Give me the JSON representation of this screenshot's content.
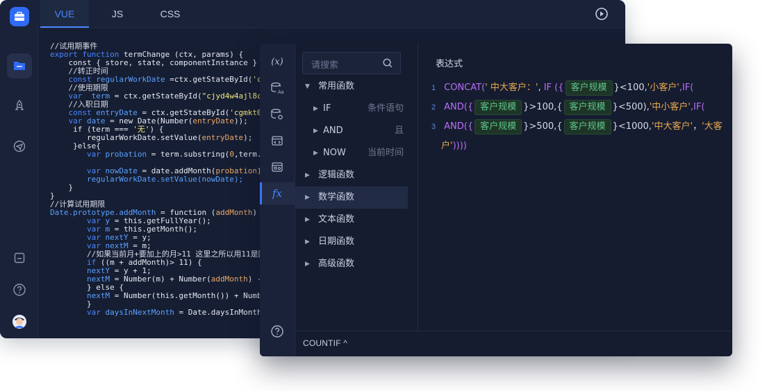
{
  "editor": {
    "tabs": [
      {
        "label": "VUE",
        "active": true
      },
      {
        "label": "JS",
        "active": false
      },
      {
        "label": "CSS",
        "active": false
      }
    ],
    "code": [
      [
        [
          "cm",
          "//试用期事件"
        ]
      ],
      [
        [
          "kw",
          "export function "
        ],
        [
          "pl",
          "termChange (ctx, params) {"
        ]
      ],
      [
        [
          "pl",
          "    const { store, state, componentInstance } = ctx;"
        ]
      ],
      [
        [
          "cm",
          "    //转正时间"
        ]
      ],
      [
        [
          "kw",
          "    const "
        ],
        [
          "vr",
          "regularWorkDate "
        ],
        [
          "pl",
          "=ctx.getStateById("
        ],
        [
          "st",
          "'coetzus"
        ]
      ],
      [
        [
          "cm",
          "    //使用期限"
        ]
      ],
      [
        [
          "kw",
          "    var  "
        ],
        [
          "vr",
          "term "
        ],
        [
          "pl",
          "= ctx.getStateById("
        ],
        [
          "st",
          "\"cjyd4w4ajl8cgz39\""
        ],
        [
          "pl",
          ")."
        ]
      ],
      [
        [
          "cm",
          "    //入职日期"
        ]
      ],
      [
        [
          "kw",
          "    const "
        ],
        [
          "vr",
          "entryDate "
        ],
        [
          "pl",
          "= ctx.getStateById("
        ],
        [
          "st",
          "'cgmkt0m3a4b"
        ]
      ],
      [
        [
          "kw",
          "    var "
        ],
        [
          "vr",
          "date "
        ],
        [
          "pl",
          "= new Date(Number("
        ],
        [
          "num",
          "entryDate"
        ],
        [
          "pl",
          "));"
        ]
      ],
      [
        [
          "pl",
          "     if (term === "
        ],
        [
          "st",
          "'无'"
        ],
        [
          "pl",
          ") {"
        ]
      ],
      [
        [
          "pl",
          "        regularWorkDate.setValue("
        ],
        [
          "num",
          "entryDate"
        ],
        [
          "pl",
          ");"
        ]
      ],
      [
        [
          "pl",
          "     }else{"
        ]
      ],
      [
        [
          "kw",
          "        var "
        ],
        [
          "vr",
          "probation "
        ],
        [
          "pl",
          "= term.substring("
        ],
        [
          "num",
          "0"
        ],
        [
          "pl",
          ",term.length-2"
        ]
      ],
      [
        [
          "pl",
          ""
        ]
      ],
      [
        [
          "kw",
          "        var "
        ],
        [
          "vr",
          "nowDate "
        ],
        [
          "pl",
          "= date.addMonth("
        ],
        [
          "num",
          "probation"
        ],
        [
          "pl",
          ");   //c"
        ]
      ],
      [
        [
          "vr",
          "        regularWorkDate.setValue(nowDate);"
        ]
      ],
      [
        [
          "pl",
          "    }"
        ]
      ],
      [
        [
          "pl",
          "}"
        ]
      ],
      [
        [
          "cm",
          "//计算试用期限"
        ]
      ],
      [
        [
          "vr",
          "Date.prototype.addMonth "
        ],
        [
          "pl",
          "= function ("
        ],
        [
          "num",
          "addMonth"
        ],
        [
          "pl",
          ") {"
        ]
      ],
      [
        [
          "kw",
          "        var "
        ],
        [
          "vr",
          "y "
        ],
        [
          "pl",
          "= this.getFullYear();"
        ]
      ],
      [
        [
          "kw",
          "        var "
        ],
        [
          "vr",
          "m "
        ],
        [
          "pl",
          "= this.getMonth();"
        ]
      ],
      [
        [
          "kw",
          "        var "
        ],
        [
          "vr",
          "nextY "
        ],
        [
          "pl",
          "= y;"
        ]
      ],
      [
        [
          "kw",
          "        var "
        ],
        [
          "vr",
          "nextM "
        ],
        [
          "pl",
          "= m;"
        ]
      ],
      [
        [
          "cm",
          "        //如果当前月+要加上的月>11 这里之所以用11是因为"
        ]
      ],
      [
        [
          "kw",
          "        if "
        ],
        [
          "pl",
          "((m + addMonth)> 11) {"
        ]
      ],
      [
        [
          "vr",
          "        nextY "
        ],
        [
          "pl",
          "= y + 1;"
        ]
      ],
      [
        [
          "vr",
          "        nextM "
        ],
        [
          "pl",
          "= Number(m) + Number("
        ],
        [
          "num",
          "addMonth"
        ],
        [
          "pl",
          ") - 12;"
        ]
      ],
      [
        [
          "pl",
          "        } else {"
        ]
      ],
      [
        [
          "vr",
          "        nextM "
        ],
        [
          "pl",
          "= Number(this.getMonth()) + Number("
        ],
        [
          "num",
          "ad"
        ]
      ],
      [
        [
          "pl",
          "        }"
        ]
      ],
      [
        [
          "kw",
          "        var "
        ],
        [
          "vr",
          "daysInNextMonth "
        ],
        [
          "pl",
          "= Date.daysInMonth("
        ],
        [
          "num",
          "next"
        ]
      ]
    ]
  },
  "formula": {
    "search_placeholder": "请搜索",
    "expr_title": "表达式",
    "tree": [
      {
        "label": "常用函数",
        "arrow": "▼",
        "level": 0,
        "desc": ""
      },
      {
        "label": "IF",
        "arrow": "▶",
        "level": 1,
        "desc": "条件语句"
      },
      {
        "label": "AND",
        "arrow": "▶",
        "level": 1,
        "desc": "且"
      },
      {
        "label": "NOW",
        "arrow": "▶",
        "level": 1,
        "desc": "当前时间"
      },
      {
        "label": "逻辑函数",
        "arrow": "▶",
        "level": 0,
        "desc": ""
      },
      {
        "label": "数学函数",
        "arrow": "▶",
        "level": 0,
        "desc": "",
        "hover": true
      },
      {
        "label": "文本函数",
        "arrow": "▶",
        "level": 0,
        "desc": ""
      },
      {
        "label": "日期函数",
        "arrow": "▶",
        "level": 0,
        "desc": ""
      },
      {
        "label": "高级函数",
        "arrow": "▶",
        "level": 0,
        "desc": ""
      }
    ],
    "expression": {
      "line1": {
        "num": "1",
        "fn": "CONCAT(",
        "str1": "' 中大客户：'",
        "sep": ",  ",
        "fn2": "IF ({",
        "field": "客户规模",
        "rest": "}<100,",
        "str2": "'小客户'",
        "tail": ",IF("
      },
      "line2": {
        "num": "2",
        "fn": "AND({",
        "field1": "客户规模",
        "mid1": "}>100,{",
        "field2": "客户规模",
        "mid2": "}<500),",
        "str": "'中小客户'",
        "tail": ",IF("
      },
      "line3": {
        "num": "3",
        "fn": "AND({",
        "field1": "客户规模",
        "mid1": "}>500,{",
        "field2": "客户规模",
        "mid2": "}<1000,",
        "str1": "'中大客户'",
        "sep": "，",
        "str2": "'大客"
      },
      "line4": {
        "str": "户'",
        "tail": "))))"
      }
    },
    "bottom_label": "COUNTIF ^"
  },
  "colors": {
    "accent": "#4b86ff",
    "function": "#b96ff4",
    "string": "#e9a84f",
    "field": "#5fc48a"
  }
}
